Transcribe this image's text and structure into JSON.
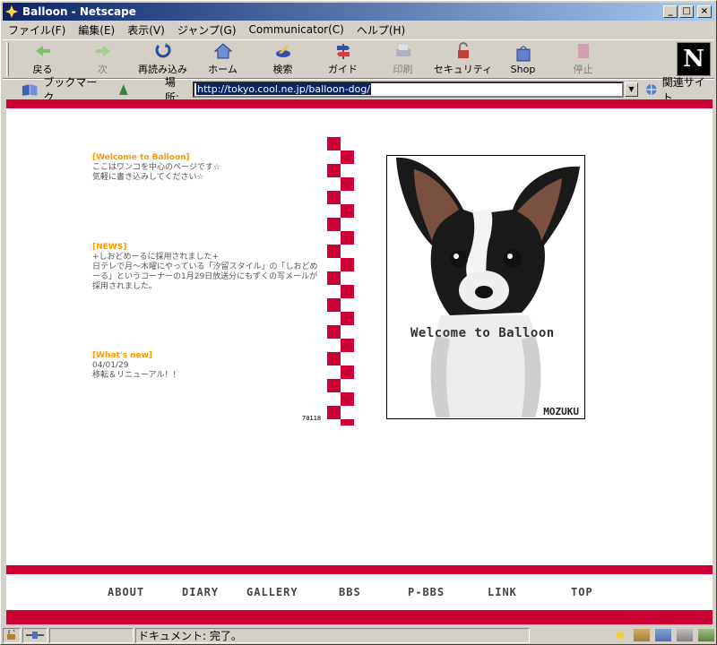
{
  "window": {
    "title": "Balloon - Netscape"
  },
  "menu": [
    "ファイル(F)",
    "編集(E)",
    "表示(V)",
    "ジャンプ(G)",
    "Communicator(C)",
    "ヘルプ(H)"
  ],
  "toolbar": {
    "back": "戻る",
    "forward": "次",
    "reload": "再読み込み",
    "home": "ホーム",
    "search": "検索",
    "guide": "ガイド",
    "print": "印刷",
    "security": "セキュリティ",
    "shop": "Shop",
    "stop": "停止"
  },
  "location": {
    "bookmarks_label": "ブックマーク",
    "label": "場所:",
    "url": "http://tokyo.cool.ne.jp/balloon-dog/",
    "related_label": "関連サイト"
  },
  "content": {
    "welcome": {
      "head": "[Welcome to Balloon]",
      "line1": "ここはワンコを中心のページです☆",
      "line2": "気軽に書き込みしてください☆"
    },
    "news": {
      "head": "[NEWS]",
      "line1": "+しおどめーるに採用されました+",
      "line2": "日テレで月～木曜にやっている「汐留スタイル」の「しおどめ",
      "line3": "ーる」というコーナーの1月29日放送分にもずくの写メールが",
      "line4": "採用されました。"
    },
    "whatsnew": {
      "head": "[What's new]",
      "date": "04/01/29",
      "line1": "移転＆リニューアル！！"
    },
    "counter": "70118",
    "photo_caption": "Welcome to Balloon",
    "photo_name": "MOZUKU"
  },
  "nav": [
    "ABOUT",
    "DIARY",
    "GALLERY",
    "BBS",
    "P-BBS",
    "LINK",
    "TOP"
  ],
  "status": {
    "text": "ドキュメント: 完了。"
  },
  "colors": {
    "band": "#cc0033",
    "accent": "#ff9900"
  }
}
